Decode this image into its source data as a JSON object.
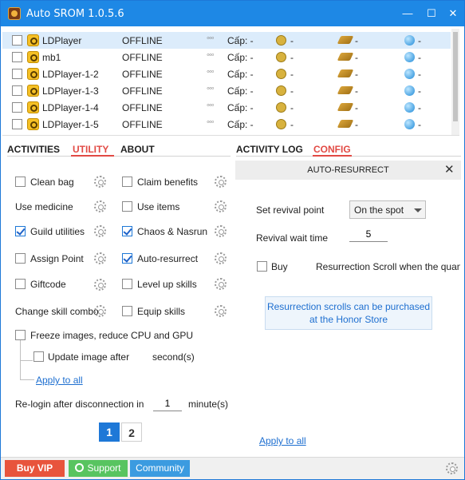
{
  "window": {
    "title": "Auto SROM 1.0.5.6",
    "controls": {
      "minimize": "—",
      "maximize": "☐",
      "close": "✕"
    }
  },
  "devices": [
    {
      "name": "LDPlayer",
      "status": "OFFLINE",
      "cap_label": "Cấp: -",
      "gold": "-",
      "skill": "-",
      "gem": "-",
      "selected": true
    },
    {
      "name": "mb1",
      "status": "OFFLINE",
      "cap_label": "Cấp: -",
      "gold": "-",
      "skill": "-",
      "gem": "-"
    },
    {
      "name": "LDPlayer-1-2",
      "status": "OFFLINE",
      "cap_label": "Cấp: -",
      "gold": "-",
      "skill": "-",
      "gem": "-"
    },
    {
      "name": "LDPlayer-1-3",
      "status": "OFFLINE",
      "cap_label": "Cấp: -",
      "gold": "-",
      "skill": "-",
      "gem": "-"
    },
    {
      "name": "LDPlayer-1-4",
      "status": "OFFLINE",
      "cap_label": "Cấp: -",
      "gold": "-",
      "skill": "-",
      "gem": "-"
    },
    {
      "name": "LDPlayer-1-5",
      "status": "OFFLINE",
      "cap_label": "Cấp: -",
      "gold": "-",
      "skill": "-",
      "gem": "-"
    }
  ],
  "device_dots": "◦◦◦",
  "left_tabs": {
    "activities": "ACTIVITIES",
    "utility": "UTILITY",
    "about": "ABOUT",
    "active": "UTILITY"
  },
  "utility": {
    "clean_bag": "Clean bag",
    "claim_benefits": "Claim benefits",
    "use_medicine": "Use medicine",
    "use_items": "Use items",
    "guild_utilities": "Guild utilities",
    "chaos_nasrun": "Chaos & Nasrun",
    "assign_point": "Assign Point",
    "auto_resurrect": "Auto-resurrect",
    "giftcode": "Giftcode",
    "level_up_skills": "Level up skills",
    "change_skill_combo": "Change skill combo",
    "equip_skills": "Equip skills",
    "freeze_images": "Freeze images, reduce CPU and GPU",
    "update_image_after": "Update image after",
    "update_unit": "second(s)",
    "apply_to_all": "Apply to all",
    "relogin_label": "Re-login after disconnection in",
    "relogin_value": "1",
    "relogin_unit": "minute(s)",
    "pages": [
      "1",
      "2"
    ]
  },
  "right_tabs": {
    "activity_log": "ACTIVITY LOG",
    "config": "CONFIG",
    "active": "CONFIG"
  },
  "config": {
    "panel_title": "AUTO-RESURRECT",
    "close": "✕",
    "revival_point_label": "Set revival point",
    "revival_point_value": "On the spot",
    "revival_wait_label": "Revival wait time",
    "revival_wait_value": "5",
    "buy_label": "Buy",
    "buy_desc": "Resurrection Scroll when the quantity",
    "info": "Resurrection scrolls can be purchased at the Honor Store",
    "apply_to_all": "Apply to all"
  },
  "bottom": {
    "buy_vip": "Buy VIP",
    "support": "Support",
    "community": "Community"
  },
  "colors": {
    "titlebar": "#1e88e5",
    "accent_red": "#e24a44",
    "link_blue": "#1e6fd0",
    "vip": "#e8543c",
    "support": "#58c460",
    "community": "#3b9be0"
  }
}
